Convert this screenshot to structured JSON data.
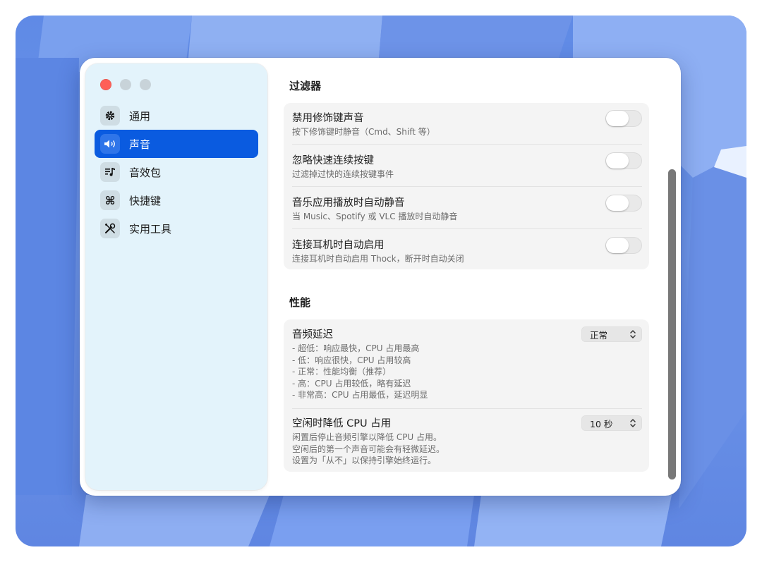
{
  "sidebar": {
    "items": [
      {
        "label": "通用",
        "icon": "gear-icon"
      },
      {
        "label": "声音",
        "icon": "speaker-icon"
      },
      {
        "label": "音效包",
        "icon": "music-list-icon"
      },
      {
        "label": "快捷键",
        "icon": "command-icon"
      },
      {
        "label": "实用工具",
        "icon": "tools-icon"
      }
    ],
    "active_index": 1
  },
  "filters": {
    "title": "过滤器",
    "rows": [
      {
        "title": "禁用修饰键声音",
        "subtitle": "按下修饰键时静音（Cmd、Shift 等）",
        "enabled": false
      },
      {
        "title": "忽略快速连续按键",
        "subtitle": "过滤掉过快的连续按键事件",
        "enabled": false
      },
      {
        "title": "音乐应用播放时自动静音",
        "subtitle": "当 Music、Spotify 或 VLC 播放时自动静音",
        "enabled": false
      },
      {
        "title": "连接耳机时自动启用",
        "subtitle": "连接耳机时自动启用 Thock，断开时自动关闭",
        "enabled": false
      }
    ]
  },
  "performance": {
    "title": "性能",
    "latency": {
      "title": "音频延迟",
      "description": "- 超低：响应最快，CPU 占用最高\n- 低：响应很快，CPU 占用较高\n- 正常：性能均衡（推荐）\n- 高：CPU 占用较低，略有延迟\n- 非常高：CPU 占用最低，延迟明显",
      "value": "正常"
    },
    "idle": {
      "title": "空闲时降低 CPU 占用",
      "description": "闲置后停止音频引擎以降低 CPU 占用。\n空闲后的第一个声音可能会有轻微延迟。\n设置为「从不」以保持引擎始终运行。",
      "value": "10 秒"
    }
  },
  "colors": {
    "accent": "#0a5be0",
    "sidebar_bg": "#e3f3fb",
    "close": "#fe5f57"
  }
}
